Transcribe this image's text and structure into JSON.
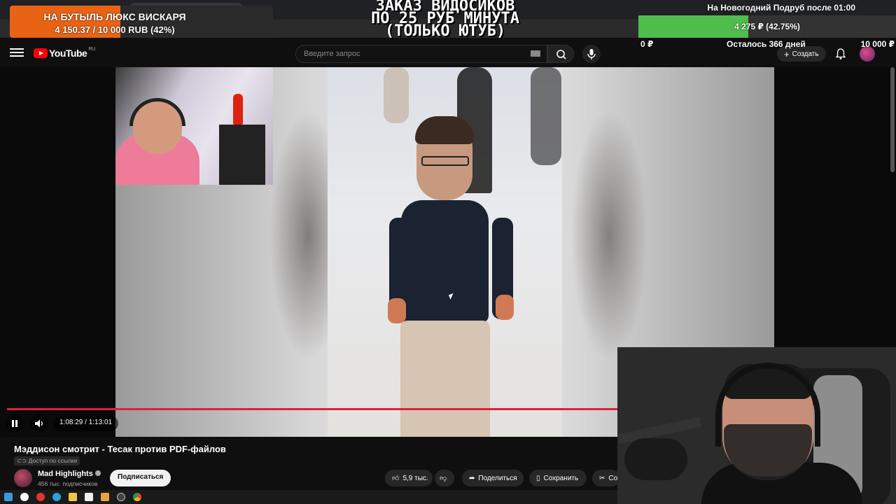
{
  "browser": {
    "tab_title": "Мэддисон смотрит - Тесак"
  },
  "header": {
    "logo_text": "YouTube",
    "region": "RU",
    "search_placeholder": "Введите запрос",
    "create_label": "Создать"
  },
  "overlays": {
    "donation_goal": {
      "title": "НА БУТЫЛЬ ЛЮКС ВИСКАРЯ",
      "amount": "4 150.37 / 10 000 RUB (42%)",
      "progress": 0.42,
      "fill_color": "#e86414"
    },
    "order_text": [
      "ЗАКАЗ ВИДОСИКОВ",
      "ПО 25 РУБ МИНУТА",
      "(ТОЛЬКО ЮТУБ)"
    ],
    "new_year_goal": {
      "title": "На Новогодний Подруб после 01:00",
      "amount": "4 275 ₽ (42.75%)",
      "progress": 0.4275,
      "min": "0 ₽",
      "remaining": "Осталось 366 дней",
      "max": "10 000 ₽",
      "fill_color": "#4fbd4b"
    }
  },
  "player": {
    "time": "1:08:29 / 1:13:01",
    "progress": 0.9378,
    "accent_color": "#e01f3d"
  },
  "video": {
    "title": "Мэддисон смотрит - Тесак против PDF-файлов",
    "access": "Доступ по ссылке",
    "channel_name": "Mad Highlights",
    "subscribers": "456 тыс. подписчиков",
    "subscribe_label": "Подписаться",
    "likes": "5,9 тыс.",
    "share_label": "Поделиться",
    "save_label": "Сохранить",
    "clip_label": "Со"
  },
  "taskbar": {
    "icons": [
      "windows-icon",
      "yandex-browser-icon",
      "yandex-icon",
      "telegram-icon",
      "explorer-icon",
      "notes-icon",
      "app-icon",
      "obs-icon",
      "chrome-icon"
    ]
  }
}
